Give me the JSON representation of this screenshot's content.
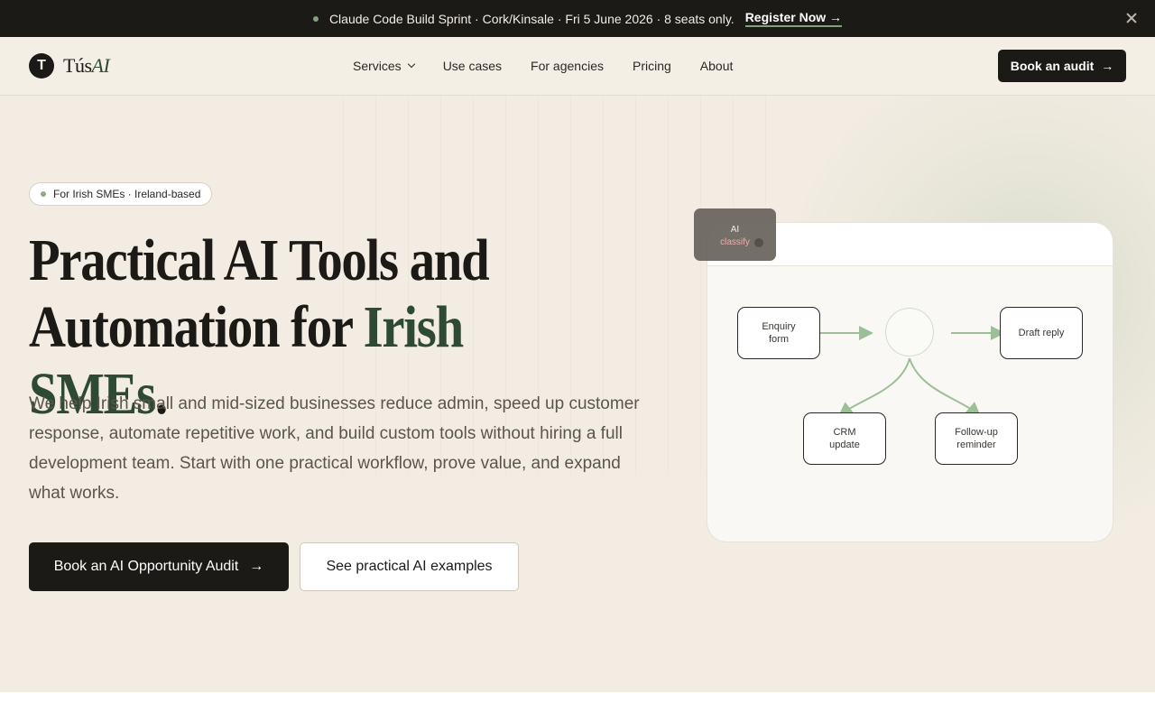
{
  "announcement": {
    "text": "Claude Code Build Sprint · Cork/Kinsale · Fri 5 June 2026 · 8 seats only.",
    "link_label": "Register Now →"
  },
  "header": {
    "logo_mark": "T",
    "logo_text": "Tús",
    "logo_accent": "AI",
    "nav": {
      "services": "Services",
      "use_cases": "Use cases",
      "for_agencies": "For agencies",
      "pricing": "Pricing",
      "about": "About"
    },
    "cta_label": "Book an audit",
    "cta_arrow": "→"
  },
  "hero": {
    "pill": "For Irish SMEs · Ireland-based",
    "title_line1": "Practical AI Tools and",
    "title_line2_start": "Automation for ",
    "title_accent": "Irish SMEs",
    "title_end": ".",
    "lead": "We help Irish small and mid-sized businesses reduce admin, speed up customer response, automate repetitive work, and build custom tools without hiring a full development team. Start with one practical workflow, prove value, and expand what works.",
    "primary_cta": "Book an AI Opportunity Audit",
    "primary_arrow": "→",
    "secondary_cta": "See practical AI examples"
  },
  "diagram": {
    "tooltip_line1": "AI",
    "tooltip_line2": "classify",
    "nodes": {
      "enquiry": "Enquiry form",
      "draft": "Draft reply",
      "crm": "CRM update",
      "followup": "Follow-up reminder"
    },
    "colors": {
      "arrow": "#9dbf98",
      "node_border": "#2a2724",
      "accent": "#2f4a34"
    }
  }
}
